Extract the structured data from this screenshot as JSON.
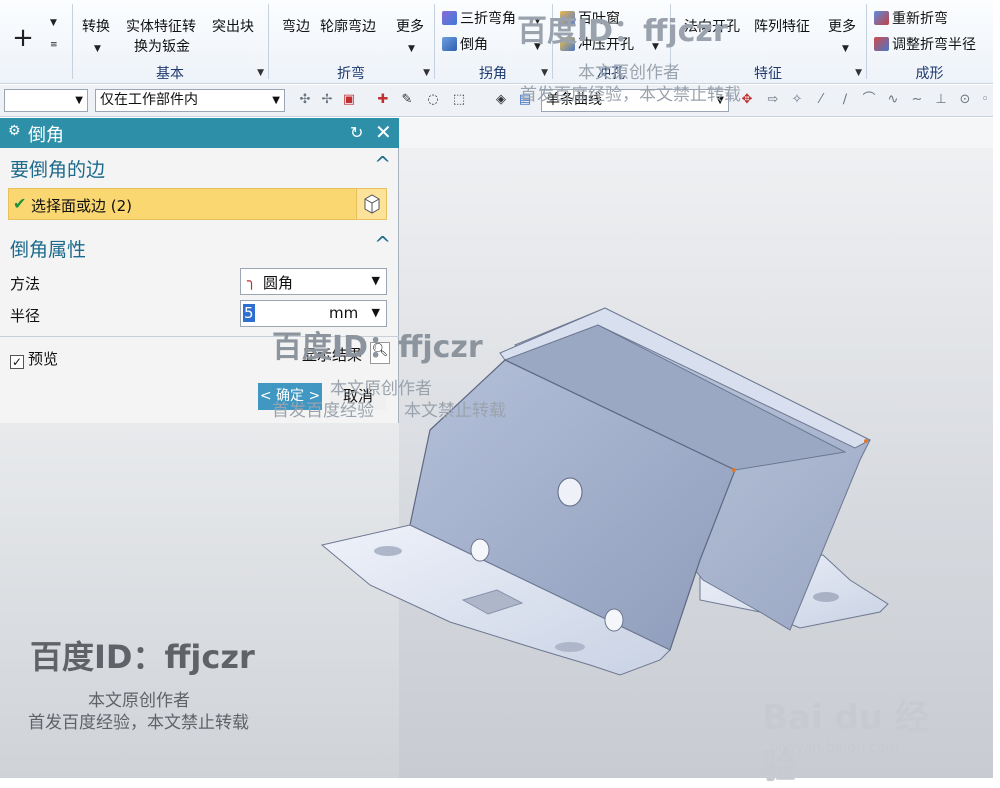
{
  "ribbon": {
    "groups": [
      {
        "label": "基本"
      },
      {
        "label": "折弯"
      },
      {
        "label": "拐角"
      },
      {
        "label": "冲孔"
      },
      {
        "label": "特征"
      },
      {
        "label": "成形"
      }
    ],
    "buttons": {
      "convert": "转换",
      "solid_to_sheet_line1": "实体特征转",
      "solid_to_sheet_line2": "换为钣金",
      "tab": "突出块",
      "bend": "弯边",
      "contour_bend": "轮廓弯边",
      "more_bend": "更多",
      "three_bend_corner": "三折弯角",
      "chamfer": "倒角",
      "louver": "百叶窗",
      "punch": "冲压开孔",
      "normal_cutout": "法向开孔",
      "pattern_feature": "阵列特征",
      "more_feature": "更多",
      "rebend": "重新折弯",
      "adjust_bend_radius": "调整折弯半径"
    }
  },
  "selection_toolbar": {
    "filter_value": "",
    "scope_value": "仅在工作部件内",
    "curve_rule_value": "单条曲线"
  },
  "dialog": {
    "title": "倒角",
    "section_edges": "要倒角的边",
    "select_label": "选择面或边 (2)",
    "section_properties": "倒角属性",
    "method_label": "方法",
    "method_value": "圆角",
    "radius_label": "半径",
    "radius_value": "5",
    "radius_unit": "mm",
    "preview_label": "预览",
    "show_result_label": "显示结果",
    "ok_label": "确定",
    "cancel_label": "取消"
  },
  "watermarks": {
    "id_text": "百度ID：ffjczr",
    "original_author": "本文原创作者",
    "first_publish": "首发百度经验，本文禁止转载",
    "first_publish_a": "首发百度经验",
    "first_publish_b": "本文禁止转载",
    "logo_text": "Bai du 经验",
    "logo_url": "jingyan.baidu.com"
  },
  "colors": {
    "dialog_title_bg": "#2d90a8",
    "selection_row_bg": "#fbd772",
    "ok_button_bg": "#3f97c2",
    "part_face": "#a9b6d1"
  }
}
